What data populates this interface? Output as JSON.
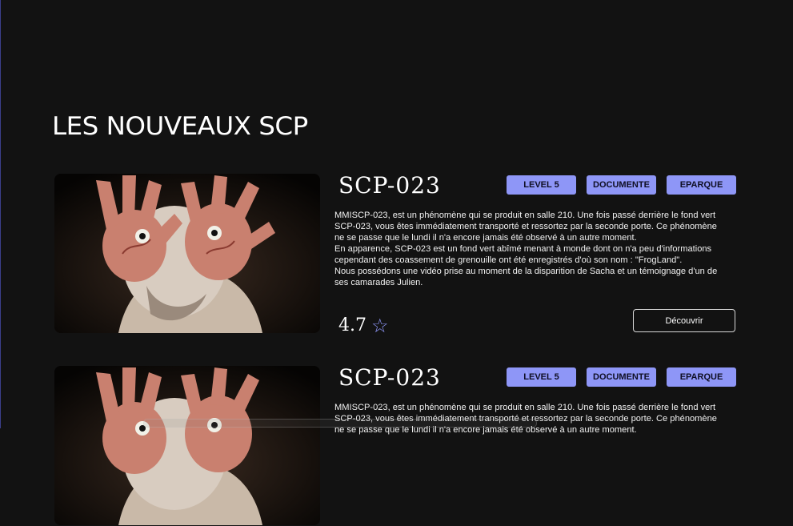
{
  "section": {
    "title": "LES NOUVEAUX SCP"
  },
  "cards": [
    {
      "title": "SCP-023",
      "badges": [
        "LEVEL 5",
        "DOCUMENTE",
        "EPARQUE"
      ],
      "description": [
        "MMISCP-023, est un phénomène qui se produit en salle 210. Une fois passé derrière le fond vert SCP-023, vous êtes immédiatement transporté et ressortez par la seconde porte. Ce phénomène ne se passe que le lundi il n'a encore jamais été observé à un autre moment.",
        "En apparence, SCP-023 est un fond vert abîmé menant à monde dont on n'a peu d'informations cependant des coassement de grenouille ont été enregistrés d'où son nom : \"FrogLand\".",
        "Nous possédons une vidéo prise au moment de la disparition de Sacha et un témoignage d'un de ses camarades Julien."
      ],
      "rating": "4.7",
      "rating_icon": "star-outline-icon",
      "button": "Découvrir"
    },
    {
      "title": "SCP-023",
      "badges": [
        "LEVEL 5",
        "DOCUMENTE",
        "EPARQUE"
      ],
      "description": [
        "MMISCP-023, est un phénomène qui se produit en salle 210. Une fois passé derrière le fond vert SCP-023, vous êtes immédiatement transporté et ressortez par la seconde porte. Ce phénomène ne se passe que le lundi il n'a encore jamais été observé à un autre moment."
      ],
      "rating": "",
      "rating_icon": "star-outline-icon",
      "button": ""
    }
  ],
  "colors": {
    "background": "#121212",
    "accent": "#8e96f7",
    "text": "#ffffff"
  }
}
